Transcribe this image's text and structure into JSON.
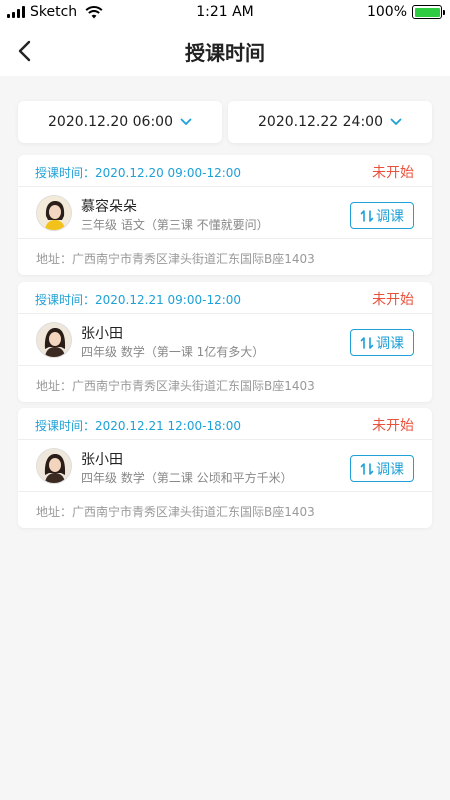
{
  "status_bar": {
    "carrier": "Sketch",
    "time": "1:21 AM",
    "battery_percent": "100%",
    "battery_level": 1.0
  },
  "nav": {
    "title": "授课时间"
  },
  "date_range": {
    "start": "2020.12.20 06:00",
    "end": "2020.12.22 24:00"
  },
  "colors": {
    "accent": "#1ea0d8",
    "status_red": "#e8523c"
  },
  "lessons": [
    {
      "time_label": "授课时间：",
      "time_value": "2020.12.20 09:00-12:00",
      "status": "未开始",
      "teacher": "慕容朵朵",
      "course": "三年级 语文（第三课 不懂就要问）",
      "button": "调课",
      "address": "地址：广西南宁市青秀区津头街道汇东国际B座1403"
    },
    {
      "time_label": "授课时间：",
      "time_value": "2020.12.21 09:00-12:00",
      "status": "未开始",
      "teacher": "张小田",
      "course": "四年级 数学（第一课 1亿有多大）",
      "button": "调课",
      "address": "地址：广西南宁市青秀区津头街道汇东国际B座1403"
    },
    {
      "time_label": "授课时间：",
      "time_value": "2020.12.21 12:00-18:00",
      "status": "未开始",
      "teacher": "张小田",
      "course": "四年级 数学（第二课 公顷和平方千米）",
      "button": "调课",
      "address": "地址：广西南宁市青秀区津头街道汇东国际B座1403"
    }
  ]
}
